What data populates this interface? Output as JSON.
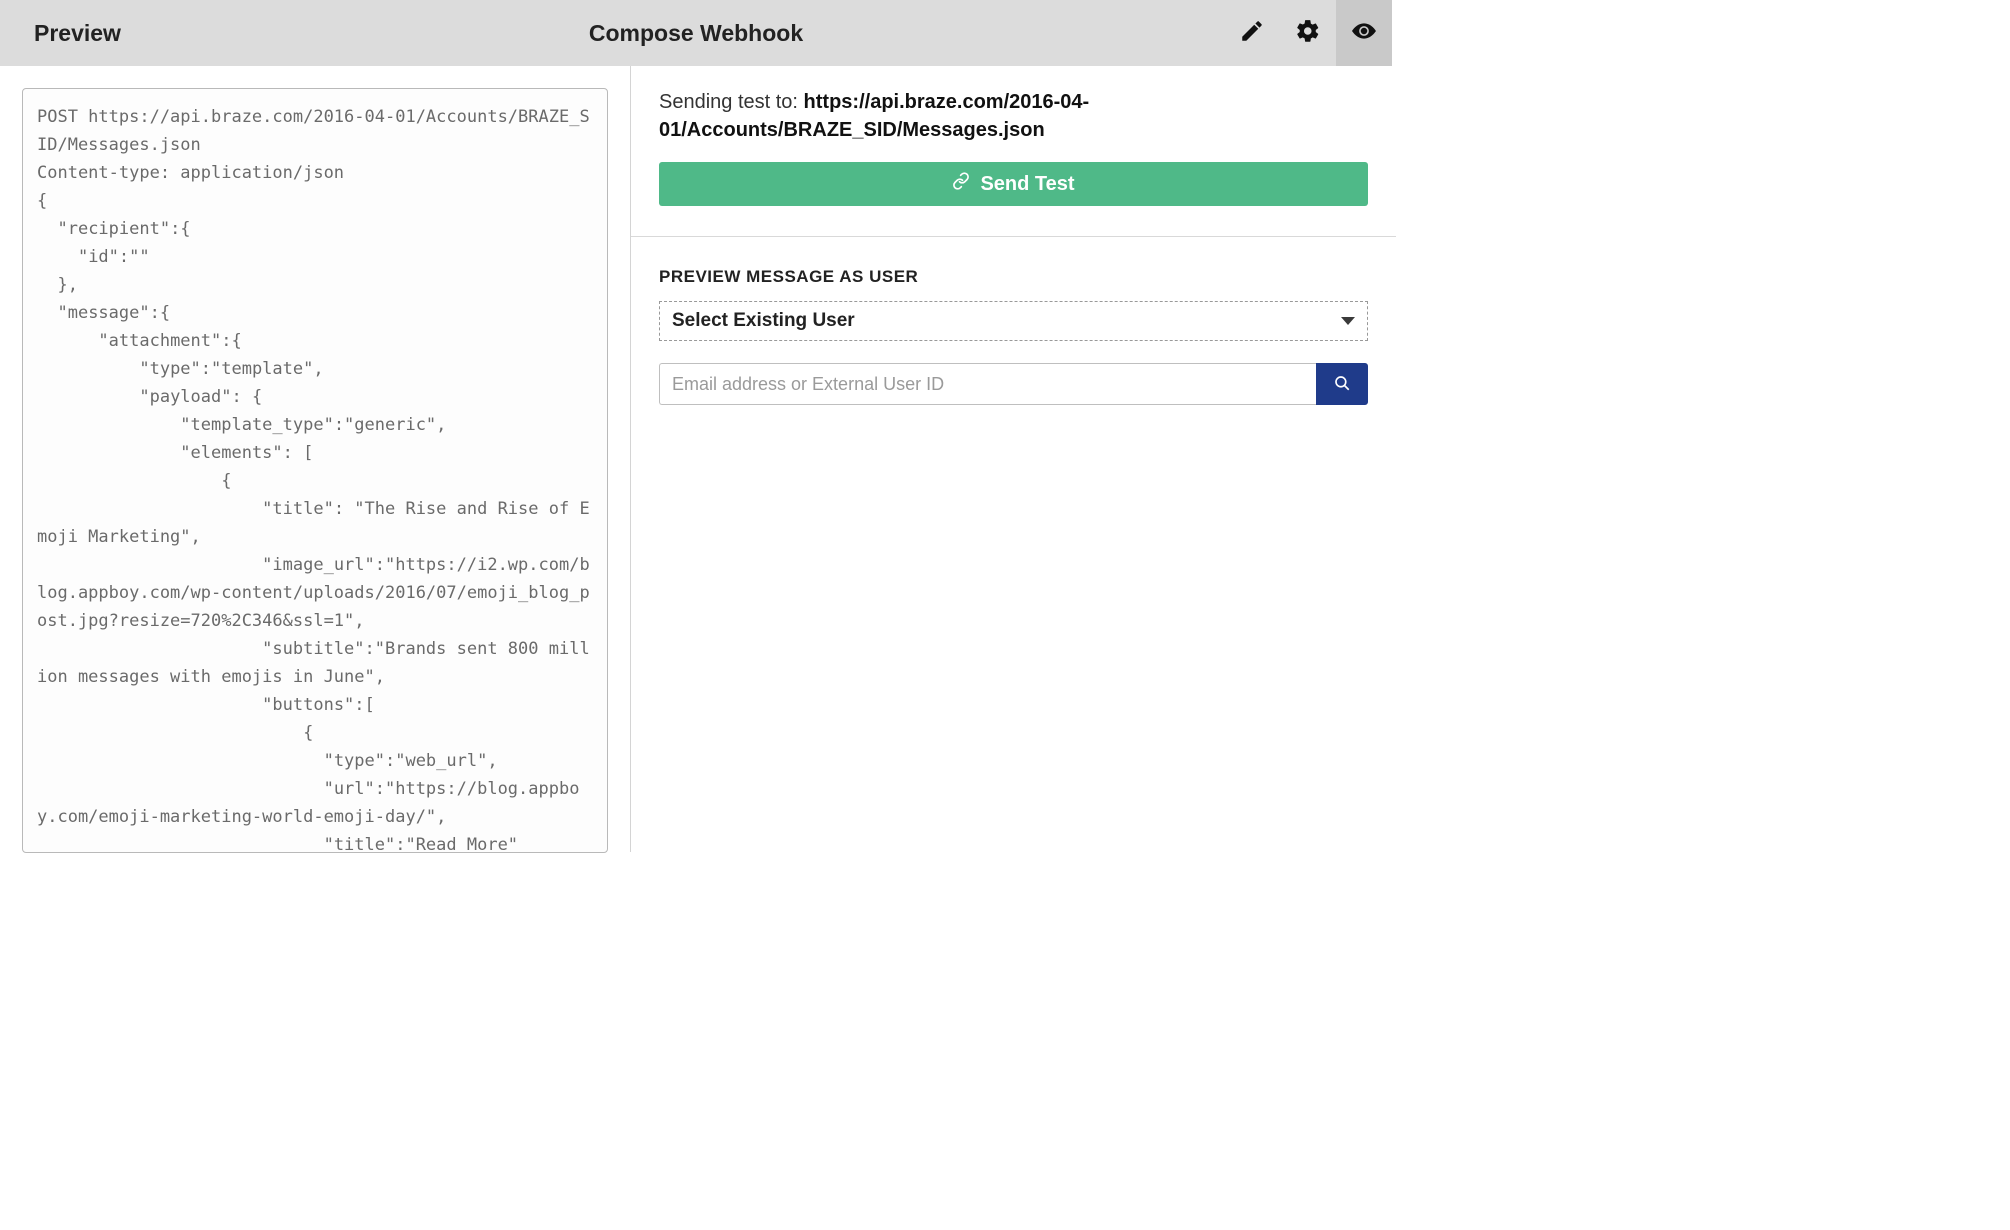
{
  "header": {
    "left_title": "Preview",
    "center_title": "Compose Webhook",
    "icons": {
      "edit": "pencil-icon",
      "settings": "gear-icon",
      "preview": "eye-icon"
    }
  },
  "code": "POST https://api.braze.com/2016-04-01/Accounts/BRAZE_SID/Messages.json\nContent-type: application/json\n{\n  \"recipient\":{\n    \"id\":\"\"\n  },\n  \"message\":{\n      \"attachment\":{\n          \"type\":\"template\",\n          \"payload\": {\n              \"template_type\":\"generic\",\n              \"elements\": [\n                  {\n                      \"title\": \"The Rise and Rise of Emoji Marketing\",\n                      \"image_url\":\"https://i2.wp.com/blog.appboy.com/wp-content/uploads/2016/07/emoji_blog_post.jpg?resize=720%2C346&ssl=1\",\n                      \"subtitle\":\"Brands sent 800 million messages with emojis in June\",\n                      \"buttons\":[\n                          {\n                            \"type\":\"web_url\",\n                            \"url\":\"https://blog.appboy.com/emoji-marketing-world-emoji-day/\",\n                            \"title\":\"Read More\"",
  "right": {
    "sending_label": "Sending test to: ",
    "sending_url": "https://api.braze.com/2016-04-01/Accounts/BRAZE_SID/Messages.json",
    "send_test_label": "Send Test",
    "preview_section_title": "PREVIEW MESSAGE AS USER",
    "select_label": "Select Existing User",
    "search_placeholder": "Email address or External User ID"
  },
  "colors": {
    "header_bg": "#dcdcdc",
    "send_btn": "#4fb988",
    "search_btn": "#1f3b8a"
  }
}
